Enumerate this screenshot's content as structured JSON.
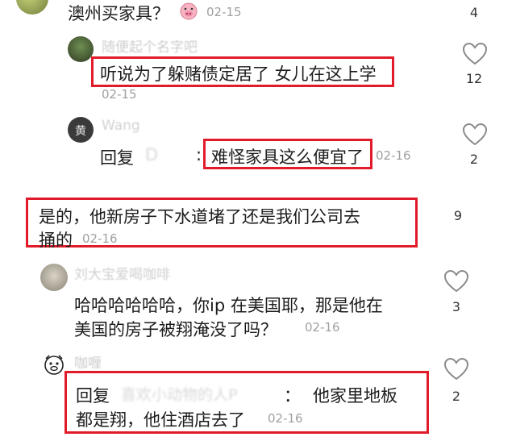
{
  "comments": [
    {
      "id": "c0",
      "text": "澳州买家具？",
      "date": "02-15",
      "likes": "4"
    },
    {
      "id": "r1",
      "username": "随便起个名字吧",
      "text": "听说为了躲赌债定居了 女儿在这上学",
      "date": "02-15",
      "likes": "12"
    },
    {
      "id": "r2",
      "username": "Wang",
      "reply_prefix": "回复",
      "reply_to": "D",
      "reply_colon": ":",
      "text": "难怪家具这么便宜了",
      "date": "02-16",
      "likes": "2"
    },
    {
      "id": "c3",
      "text_line1": "是的，他新房子下水道堵了还是我们公司去",
      "text_line2": "捅的",
      "date": "02-16",
      "likes": "9"
    },
    {
      "id": "r4",
      "username": "刘大宝爱喝咖啡",
      "text_line1": "哈哈哈哈哈哈，你ip 在美国耶，那是他在",
      "text_line2": "美国的房子被翔淹没了吗？",
      "date": "02-16",
      "likes": "3"
    },
    {
      "id": "r5",
      "username": "咖喱",
      "reply_prefix": "回复",
      "reply_to": "喜欢小动物的人P",
      "reply_colon": "：",
      "text_line1": "他家里地板",
      "text_line2": "都是翔，他住酒店去了",
      "date": "02-16",
      "likes": "2"
    }
  ],
  "colors": {
    "highlight_border": "#e21b2a",
    "date": "#a0a0a0",
    "text": "#1c1c1c"
  },
  "icons": {
    "like": "heart-outline-icon",
    "emoji": "pig-face-emoji"
  }
}
